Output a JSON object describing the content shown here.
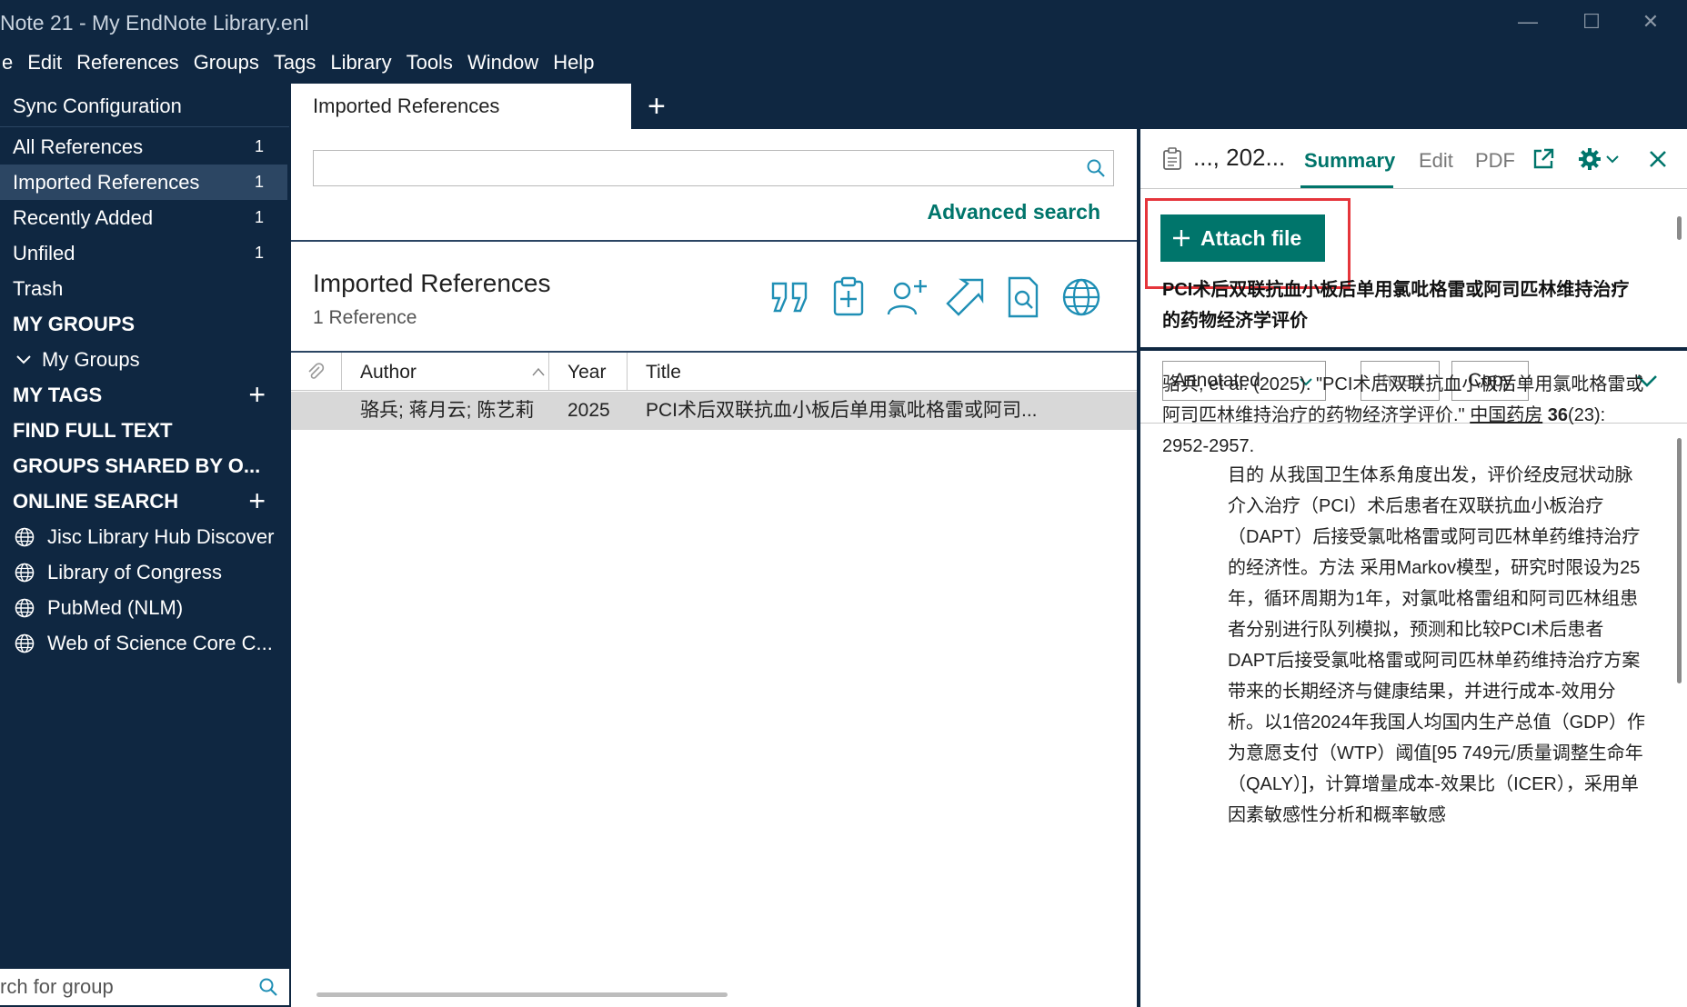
{
  "window": {
    "title": "Note 21 - My EndNote Library.enl",
    "minimize": "—",
    "maximize": "☐",
    "close": "✕"
  },
  "menu": [
    "e",
    "Edit",
    "References",
    "Groups",
    "Tags",
    "Library",
    "Tools",
    "Window",
    "Help"
  ],
  "sidebar": {
    "sync": "Sync Configuration",
    "items": [
      {
        "label": "All References",
        "count": "1"
      },
      {
        "label": "Imported References",
        "count": "1"
      },
      {
        "label": "Recently Added",
        "count": "1"
      },
      {
        "label": "Unfiled",
        "count": "1"
      },
      {
        "label": "Trash",
        "count": ""
      }
    ],
    "my_groups_header": "MY GROUPS",
    "my_groups_child": "My Groups",
    "my_tags_header": "MY TAGS",
    "find_full_text": "FIND FULL TEXT",
    "groups_shared": "GROUPS SHARED BY O...",
    "online_search": "ONLINE SEARCH",
    "online_items": [
      "Jisc Library Hub Discover",
      "Library of Congress",
      "PubMed (NLM)",
      "Web of Science Core C..."
    ],
    "search_placeholder": "rch for group"
  },
  "center": {
    "tab_label": "Imported References",
    "tab_add": "+",
    "advanced_search": "Advanced search",
    "library_title": "Imported References",
    "library_count": "1 Reference",
    "columns": {
      "author": "Author",
      "year": "Year",
      "title": "Title"
    },
    "rows": [
      {
        "author": "骆兵; 蒋月云; 陈艺莉",
        "year": "2025",
        "title": "PCI术后双联抗血小板后单用氯吡格雷或阿司..."
      }
    ]
  },
  "right": {
    "ref_short": "..., 202...",
    "tabs": {
      "summary": "Summary",
      "edit": "Edit",
      "pdf": "PDF"
    },
    "attach_file": "Attach file",
    "ref_title": "PCI术后双联抗血小板后单用氯吡格雷或阿司匹林维持治疗的药物经济学评价",
    "style_select": "Annotated",
    "insert": "Insert",
    "copy": "Copy",
    "citation_prefix": "骆兵, et al. (2025). \"PCI术后双联抗血小板后单用氯吡格雷或阿司匹林维持治疗的药物经济学评价.\" ",
    "journal": "中国药房",
    "volume": "36",
    "issue_pages": "(23): 2952-2957.",
    "abstract": "目的 从我国卫生体系角度出发，评价经皮冠状动脉介入治疗（PCI）术后患者在双联抗血小板治疗（DAPT）后接受氯吡格雷或阿司匹林单药维持治疗的经济性。方法 采用Markov模型，研究时限设为25年，循环周期为1年，对氯吡格雷组和阿司匹林组患者分别进行队列模拟，预测和比较PCI术后患者DAPT后接受氯吡格雷或阿司匹林单药维持治疗方案带来的长期经济与健康结果，并进行成本-效用分析。以1倍2024年我国人均国内生产总值（GDP）作为意愿支付（WTP）阈值[95 749元/质量调整生命年（QALY）]，计算增量成本-效果比（ICER），采用单因素敏感性分析和概率敏感"
  },
  "colors": {
    "navy": "#0f2741",
    "teal": "#00756b",
    "highlight_red": "#e5353b",
    "selected_row": "#d8d8d8"
  }
}
